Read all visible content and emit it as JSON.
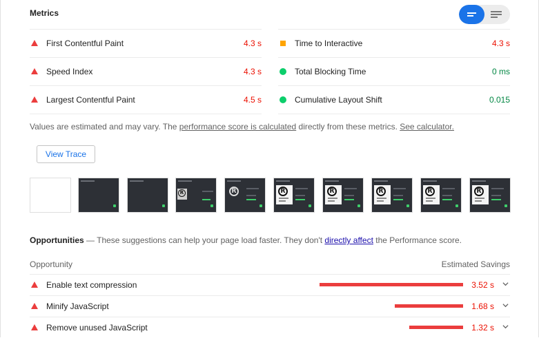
{
  "metrics": {
    "title": "Metrics",
    "left": [
      {
        "label": "First Contentful Paint",
        "value": "4.3 s",
        "status": "fail"
      },
      {
        "label": "Speed Index",
        "value": "4.3 s",
        "status": "fail"
      },
      {
        "label": "Largest Contentful Paint",
        "value": "4.5 s",
        "status": "fail"
      }
    ],
    "right": [
      {
        "label": "Time to Interactive",
        "value": "4.3 s",
        "status": "average"
      },
      {
        "label": "Total Blocking Time",
        "value": "0 ms",
        "status": "pass"
      },
      {
        "label": "Cumulative Layout Shift",
        "value": "0.015",
        "status": "pass"
      }
    ],
    "note_prefix": "Values are estimated and may vary. The ",
    "note_link1": "performance score is calculated",
    "note_middle": " directly from these metrics. ",
    "note_link2": "See calculator."
  },
  "view_toggle": {
    "active": "compact-view",
    "options": [
      "compact-view-icon",
      "expanded-view-icon"
    ]
  },
  "trace_button": "View Trace",
  "filmstrip": {
    "frames": [
      "blank",
      "dark",
      "dark",
      "loading-logo",
      "logo",
      "logo-card",
      "logo-card",
      "logo-card",
      "logo-card",
      "logo-card"
    ]
  },
  "opportunities": {
    "title": "Opportunities",
    "dash": " — ",
    "description_prefix": "These suggestions can help your page load faster. They don't ",
    "description_link": "directly affect",
    "description_suffix": " the Performance score.",
    "col_opportunity": "Opportunity",
    "col_savings": "Estimated Savings",
    "items": [
      {
        "label": "Enable text compression",
        "savings": "3.52 s",
        "savings_seconds": 3.52
      },
      {
        "label": "Minify JavaScript",
        "savings": "1.68 s",
        "savings_seconds": 1.68
      },
      {
        "label": "Remove unused JavaScript",
        "savings": "1.32 s",
        "savings_seconds": 1.32
      }
    ]
  },
  "colors": {
    "fail": "#eb3d3d",
    "average": "#ffa400",
    "pass": "#0cce6b",
    "accent": "#1a73e8"
  }
}
